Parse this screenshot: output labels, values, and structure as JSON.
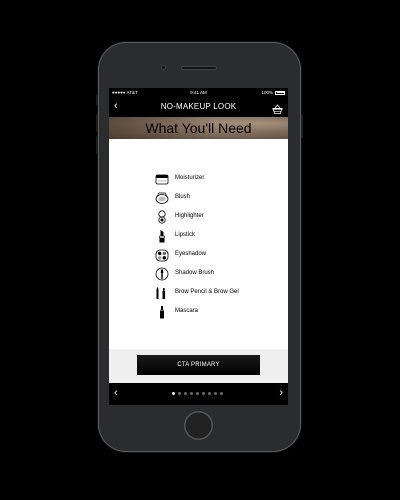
{
  "status_bar": {
    "carrier": "●●●●● AT&T",
    "time": "9:41 AM",
    "battery": "100%"
  },
  "nav": {
    "back_icon": "‹",
    "title": "NO-MAKEUP LOOK",
    "basket_icon": "basket-icon"
  },
  "hero": {
    "title": "What You'll Need"
  },
  "items": [
    {
      "label": "Moisturizer",
      "icon": "moisturizer-icon"
    },
    {
      "label": "Blush",
      "icon": "blush-icon"
    },
    {
      "label": "Highlighter",
      "icon": "highlighter-icon"
    },
    {
      "label": "Lipstick",
      "icon": "lipstick-icon"
    },
    {
      "label": "Eyeshadow",
      "icon": "eyeshadow-icon"
    },
    {
      "label": "Shadow Brush",
      "icon": "brush-icon"
    },
    {
      "label": "Brow Pencil & Brow Gel",
      "icon": "brow-pencil-icon"
    },
    {
      "label": "Mascara",
      "icon": "mascara-icon"
    }
  ],
  "cta": {
    "label": "CTA PRIMARY"
  },
  "pager": {
    "prev_icon": "‹",
    "next_icon": "›",
    "pages": 9,
    "current_page": 1
  }
}
